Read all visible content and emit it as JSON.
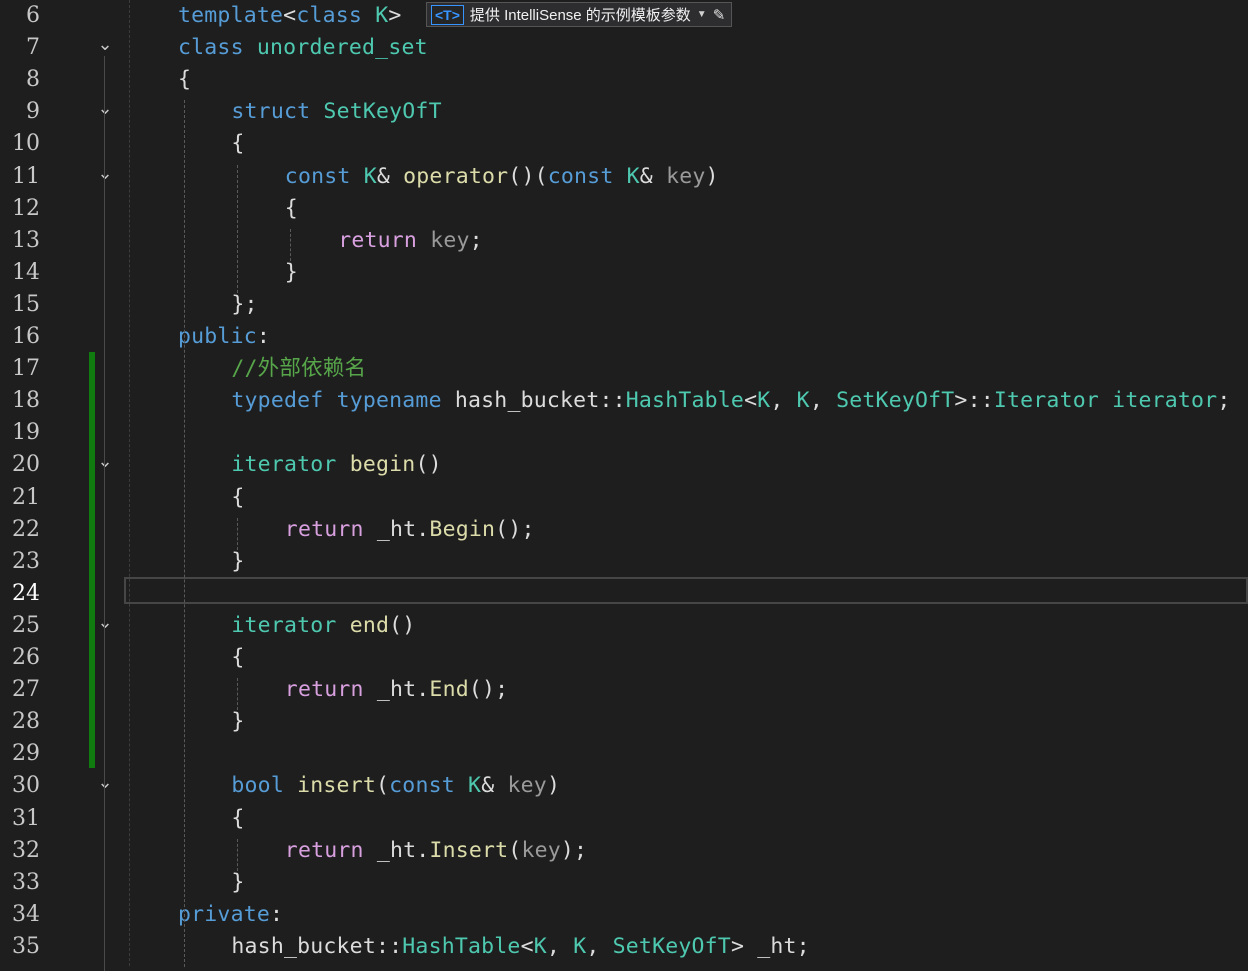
{
  "editor": {
    "lines": [
      {
        "n": "6",
        "fold": false,
        "indent": 0,
        "tokens": [
          [
            "template",
            "kw"
          ],
          [
            "<",
            "text"
          ],
          [
            "class",
            "kw"
          ],
          [
            " ",
            "text"
          ],
          [
            "K",
            "type"
          ],
          [
            ">",
            "text"
          ]
        ]
      },
      {
        "n": "7",
        "fold": true,
        "indent": 0,
        "tokens": [
          [
            "class",
            "kw"
          ],
          [
            " ",
            "text"
          ],
          [
            "unordered_set",
            "type"
          ]
        ]
      },
      {
        "n": "8",
        "fold": false,
        "indent": 0,
        "tokens": [
          [
            "{",
            "text"
          ]
        ]
      },
      {
        "n": "9",
        "fold": true,
        "indent": 1,
        "tokens": [
          [
            "struct",
            "kw"
          ],
          [
            " ",
            "text"
          ],
          [
            "SetKeyOfT",
            "type"
          ]
        ]
      },
      {
        "n": "10",
        "fold": false,
        "indent": 1,
        "tokens": [
          [
            "{",
            "text"
          ]
        ]
      },
      {
        "n": "11",
        "fold": true,
        "indent": 2,
        "tokens": [
          [
            "const",
            "kw"
          ],
          [
            " ",
            "text"
          ],
          [
            "K",
            "type"
          ],
          [
            "& ",
            "text"
          ],
          [
            "operator",
            "fn"
          ],
          [
            "()",
            "text"
          ],
          [
            "(",
            "text"
          ],
          [
            "const",
            "kw"
          ],
          [
            " ",
            "text"
          ],
          [
            "K",
            "type"
          ],
          [
            "& ",
            "text"
          ],
          [
            "key",
            "param"
          ],
          [
            ")",
            "text"
          ]
        ]
      },
      {
        "n": "12",
        "fold": false,
        "indent": 2,
        "tokens": [
          [
            "{",
            "text"
          ]
        ]
      },
      {
        "n": "13",
        "fold": false,
        "indent": 3,
        "tokens": [
          [
            "return",
            "ctrl"
          ],
          [
            " ",
            "text"
          ],
          [
            "key",
            "param"
          ],
          [
            ";",
            "text"
          ]
        ]
      },
      {
        "n": "14",
        "fold": false,
        "indent": 2,
        "tokens": [
          [
            "}",
            "text"
          ]
        ]
      },
      {
        "n": "15",
        "fold": false,
        "indent": 1,
        "tokens": [
          [
            "};",
            "text"
          ]
        ]
      },
      {
        "n": "16",
        "fold": false,
        "indent": 0,
        "tokens": [
          [
            "public",
            "kw"
          ],
          [
            ":",
            "text"
          ]
        ]
      },
      {
        "n": "17",
        "fold": false,
        "indent": 1,
        "tokens": [
          [
            "//外部依赖名",
            "cmt"
          ]
        ]
      },
      {
        "n": "18",
        "fold": false,
        "indent": 1,
        "tokens": [
          [
            "typedef",
            "kw"
          ],
          [
            " ",
            "text"
          ],
          [
            "typename",
            "kw"
          ],
          [
            " ",
            "text"
          ],
          [
            "hash_bucket",
            "text"
          ],
          [
            "::",
            "text"
          ],
          [
            "HashTable",
            "type"
          ],
          [
            "<",
            "text"
          ],
          [
            "K",
            "type"
          ],
          [
            ", ",
            "text"
          ],
          [
            "K",
            "type"
          ],
          [
            ", ",
            "text"
          ],
          [
            "SetKeyOfT",
            "type"
          ],
          [
            ">::",
            "text"
          ],
          [
            "Iterator",
            "type"
          ],
          [
            " ",
            "text"
          ],
          [
            "iterator",
            "type"
          ],
          [
            ";",
            "text"
          ]
        ]
      },
      {
        "n": "19",
        "fold": false,
        "indent": 1,
        "tokens": []
      },
      {
        "n": "20",
        "fold": true,
        "indent": 1,
        "tokens": [
          [
            "iterator",
            "type"
          ],
          [
            " ",
            "text"
          ],
          [
            "begin",
            "fn"
          ],
          [
            "()",
            "text"
          ]
        ]
      },
      {
        "n": "21",
        "fold": false,
        "indent": 1,
        "tokens": [
          [
            "{",
            "text"
          ]
        ]
      },
      {
        "n": "22",
        "fold": false,
        "indent": 2,
        "tokens": [
          [
            "return",
            "ctrl"
          ],
          [
            " ",
            "text"
          ],
          [
            "_ht",
            "text"
          ],
          [
            ".",
            "text"
          ],
          [
            "Begin",
            "fn"
          ],
          [
            "();",
            "text"
          ]
        ]
      },
      {
        "n": "23",
        "fold": false,
        "indent": 1,
        "tokens": [
          [
            "}",
            "text"
          ]
        ]
      },
      {
        "n": "24",
        "fold": false,
        "indent": 1,
        "current": true,
        "tokens": []
      },
      {
        "n": "25",
        "fold": true,
        "indent": 1,
        "tokens": [
          [
            "iterator",
            "type"
          ],
          [
            " ",
            "text"
          ],
          [
            "end",
            "fn"
          ],
          [
            "()",
            "text"
          ]
        ]
      },
      {
        "n": "26",
        "fold": false,
        "indent": 1,
        "tokens": [
          [
            "{",
            "text"
          ]
        ]
      },
      {
        "n": "27",
        "fold": false,
        "indent": 2,
        "tokens": [
          [
            "return",
            "ctrl"
          ],
          [
            " ",
            "text"
          ],
          [
            "_ht",
            "text"
          ],
          [
            ".",
            "text"
          ],
          [
            "End",
            "fn"
          ],
          [
            "();",
            "text"
          ]
        ]
      },
      {
        "n": "28",
        "fold": false,
        "indent": 1,
        "tokens": [
          [
            "}",
            "text"
          ]
        ]
      },
      {
        "n": "29",
        "fold": false,
        "indent": 1,
        "tokens": []
      },
      {
        "n": "30",
        "fold": true,
        "indent": 1,
        "tokens": [
          [
            "bool",
            "kw"
          ],
          [
            " ",
            "text"
          ],
          [
            "insert",
            "fn"
          ],
          [
            "(",
            "text"
          ],
          [
            "const",
            "kw"
          ],
          [
            " ",
            "text"
          ],
          [
            "K",
            "type"
          ],
          [
            "& ",
            "text"
          ],
          [
            "key",
            "param"
          ],
          [
            ")",
            "text"
          ]
        ]
      },
      {
        "n": "31",
        "fold": false,
        "indent": 1,
        "tokens": [
          [
            "{",
            "text"
          ]
        ]
      },
      {
        "n": "32",
        "fold": false,
        "indent": 2,
        "tokens": [
          [
            "return",
            "ctrl"
          ],
          [
            " ",
            "text"
          ],
          [
            "_ht",
            "text"
          ],
          [
            ".",
            "text"
          ],
          [
            "Insert",
            "fn"
          ],
          [
            "(",
            "text"
          ],
          [
            "key",
            "param"
          ],
          [
            ");",
            "text"
          ]
        ]
      },
      {
        "n": "33",
        "fold": false,
        "indent": 1,
        "tokens": [
          [
            "}",
            "text"
          ]
        ]
      },
      {
        "n": "34",
        "fold": false,
        "indent": 0,
        "tokens": [
          [
            "private",
            "kw"
          ],
          [
            ":",
            "text"
          ]
        ]
      },
      {
        "n": "35",
        "fold": false,
        "indent": 1,
        "tokens": [
          [
            "hash_bucket",
            "text"
          ],
          [
            "::",
            "text"
          ],
          [
            "HashTable",
            "type"
          ],
          [
            "<",
            "text"
          ],
          [
            "K",
            "type"
          ],
          [
            ", ",
            "text"
          ],
          [
            "K",
            "type"
          ],
          [
            ", ",
            "text"
          ],
          [
            "SetKeyOfT",
            "type"
          ],
          [
            "> ",
            "text"
          ],
          [
            "_ht",
            "text"
          ],
          [
            ";",
            "text"
          ]
        ]
      }
    ]
  },
  "intellisense": {
    "tag": "<T>",
    "label": "提供 IntelliSense 的示例模板参数",
    "caret_icon": "chevron-down-icon",
    "edit_icon": "pencil-icon"
  },
  "colors": {
    "background": "#1e1e1e",
    "keyword": "#569cd6",
    "control": "#d8a0df",
    "type": "#4ec9b0",
    "function": "#dcdcaa",
    "comment": "#57a64a",
    "change_bar": "#107c10"
  }
}
